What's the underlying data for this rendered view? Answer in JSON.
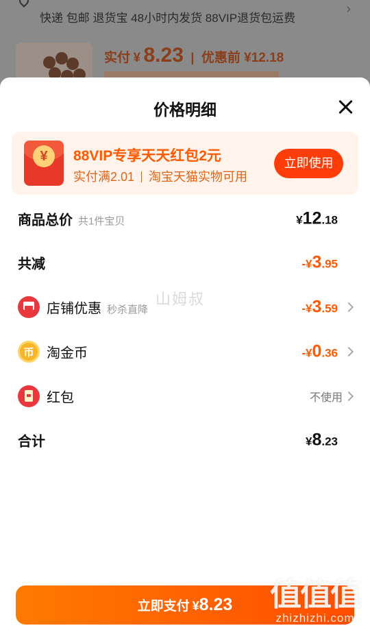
{
  "background": {
    "service_line": "快递 包邮 退货宝 48小时内发货 88VIP退货包运费",
    "price_label": "实付",
    "price_currency": "¥",
    "price_value": "8.23",
    "price_before": "优惠前 ¥12.18"
  },
  "sheet": {
    "title": "价格明细",
    "promo": {
      "title": "88VIP专享天天红包2元",
      "condition": "实付满2.01",
      "scope": "淘宝天猫实物可用",
      "button": "立即使用",
      "envelope_glyph": "¥"
    },
    "rows": [
      {
        "label": "商品总价",
        "sub": "共1件宝贝",
        "prefix": "",
        "currency": "¥",
        "int": "12",
        "dec": ".18"
      },
      {
        "label": "共减",
        "sub": "",
        "prefix": "-",
        "currency": "¥",
        "int": "3",
        "dec": ".95"
      },
      {
        "label": "店铺优惠",
        "sub": "秒杀直降",
        "prefix": "-",
        "currency": "¥",
        "int": "3",
        "dec": ".59"
      },
      {
        "label": "淘金币",
        "sub": "",
        "prefix": "-",
        "currency": "¥",
        "int": "0",
        "dec": ".36"
      },
      {
        "label": "红包",
        "sub": "",
        "status": "不使用"
      },
      {
        "label": "合计",
        "sub": "",
        "prefix": "",
        "currency": "¥",
        "int": "8",
        "dec": ".23"
      }
    ],
    "coin_glyph": "币",
    "watermark": "山姆叔",
    "pay_button": {
      "text": "立即支付",
      "currency": "¥",
      "amount": "8.23"
    }
  },
  "brand": {
    "logo": "值值值",
    "site": "zhizhizhi.com"
  },
  "colors": {
    "accent": "#ff5a00",
    "button": "#ff3d0b",
    "promo_bg": "#fff3ec"
  }
}
